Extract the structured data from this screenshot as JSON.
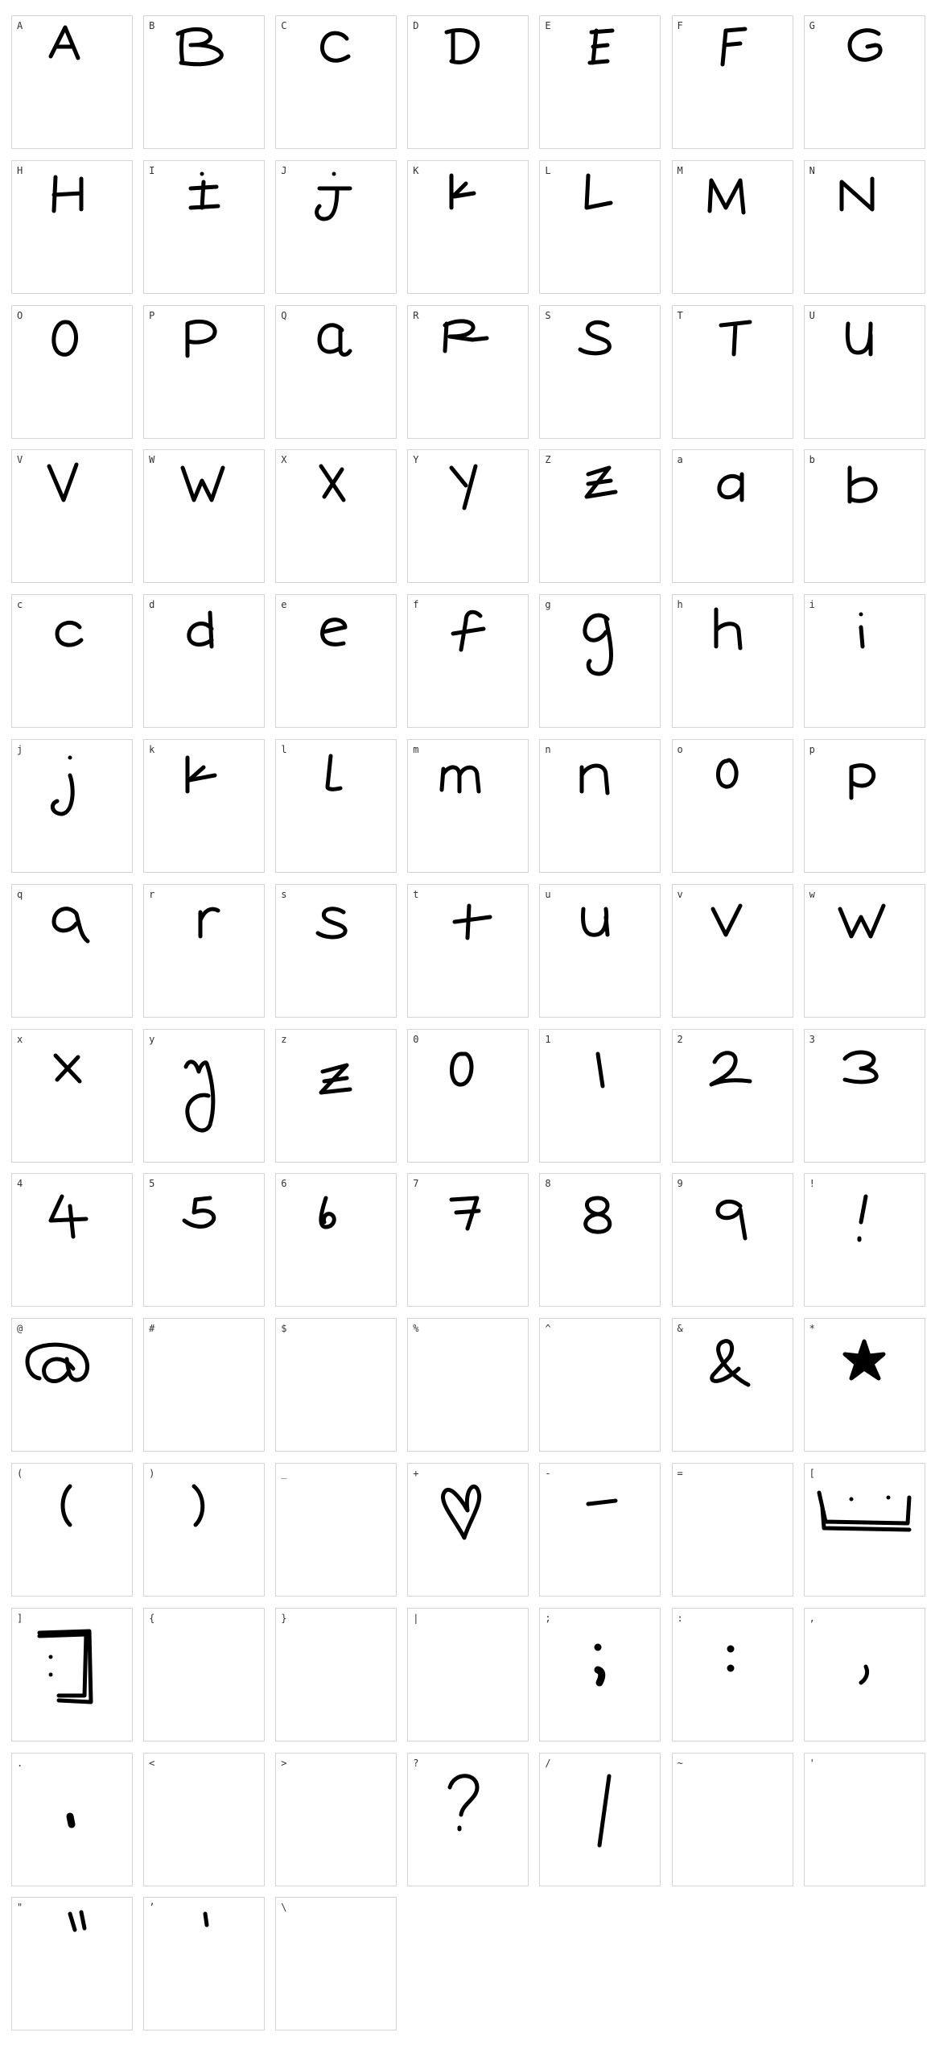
{
  "glyph_color": "#000000",
  "cell_border_color": "#d4d4d4",
  "cells": [
    {
      "label": "A",
      "drawn": true
    },
    {
      "label": "B",
      "drawn": true
    },
    {
      "label": "C",
      "drawn": true
    },
    {
      "label": "D",
      "drawn": true
    },
    {
      "label": "E",
      "drawn": true
    },
    {
      "label": "F",
      "drawn": true
    },
    {
      "label": "G",
      "drawn": true
    },
    {
      "label": "H",
      "drawn": true
    },
    {
      "label": "I",
      "drawn": true
    },
    {
      "label": "J",
      "drawn": true
    },
    {
      "label": "K",
      "drawn": true
    },
    {
      "label": "L",
      "drawn": true
    },
    {
      "label": "M",
      "drawn": true
    },
    {
      "label": "N",
      "drawn": true
    },
    {
      "label": "O",
      "drawn": true
    },
    {
      "label": "P",
      "drawn": true
    },
    {
      "label": "Q",
      "drawn": true
    },
    {
      "label": "R",
      "drawn": true
    },
    {
      "label": "S",
      "drawn": true
    },
    {
      "label": "T",
      "drawn": true
    },
    {
      "label": "U",
      "drawn": true
    },
    {
      "label": "V",
      "drawn": true
    },
    {
      "label": "W",
      "drawn": true
    },
    {
      "label": "X",
      "drawn": true
    },
    {
      "label": "Y",
      "drawn": true
    },
    {
      "label": "Z",
      "drawn": true
    },
    {
      "label": "a",
      "drawn": true
    },
    {
      "label": "b",
      "drawn": true
    },
    {
      "label": "c",
      "drawn": true
    },
    {
      "label": "d",
      "drawn": true
    },
    {
      "label": "e",
      "drawn": true
    },
    {
      "label": "f",
      "drawn": true
    },
    {
      "label": "g",
      "drawn": true
    },
    {
      "label": "h",
      "drawn": true
    },
    {
      "label": "i",
      "drawn": true
    },
    {
      "label": "j",
      "drawn": true
    },
    {
      "label": "k",
      "drawn": true
    },
    {
      "label": "l",
      "drawn": true
    },
    {
      "label": "m",
      "drawn": true
    },
    {
      "label": "n",
      "drawn": true
    },
    {
      "label": "o",
      "drawn": true
    },
    {
      "label": "p",
      "drawn": true
    },
    {
      "label": "q",
      "drawn": true
    },
    {
      "label": "r",
      "drawn": true
    },
    {
      "label": "s",
      "drawn": true
    },
    {
      "label": "t",
      "drawn": true
    },
    {
      "label": "u",
      "drawn": true
    },
    {
      "label": "v",
      "drawn": true
    },
    {
      "label": "w",
      "drawn": true
    },
    {
      "label": "x",
      "drawn": true
    },
    {
      "label": "y",
      "drawn": true
    },
    {
      "label": "z",
      "drawn": true
    },
    {
      "label": "0",
      "drawn": true
    },
    {
      "label": "1",
      "drawn": true
    },
    {
      "label": "2",
      "drawn": true
    },
    {
      "label": "3",
      "drawn": true
    },
    {
      "label": "4",
      "drawn": true
    },
    {
      "label": "5",
      "drawn": true
    },
    {
      "label": "6",
      "drawn": true
    },
    {
      "label": "7",
      "drawn": true
    },
    {
      "label": "8",
      "drawn": true
    },
    {
      "label": "9",
      "drawn": true
    },
    {
      "label": "!",
      "drawn": true
    },
    {
      "label": "@",
      "drawn": true
    },
    {
      "label": "#",
      "drawn": false
    },
    {
      "label": "$",
      "drawn": false
    },
    {
      "label": "%",
      "drawn": false
    },
    {
      "label": "^",
      "drawn": false
    },
    {
      "label": "&",
      "drawn": true
    },
    {
      "label": "*",
      "drawn": true
    },
    {
      "label": "(",
      "drawn": true
    },
    {
      "label": ")",
      "drawn": true
    },
    {
      "label": "_",
      "drawn": false
    },
    {
      "label": "+",
      "drawn": true
    },
    {
      "label": "-",
      "drawn": true
    },
    {
      "label": "=",
      "drawn": false
    },
    {
      "label": "[",
      "drawn": true
    },
    {
      "label": "]",
      "drawn": true
    },
    {
      "label": "{",
      "drawn": false
    },
    {
      "label": "}",
      "drawn": false
    },
    {
      "label": "|",
      "drawn": false
    },
    {
      "label": ";",
      "drawn": true
    },
    {
      "label": ":",
      "drawn": true
    },
    {
      "label": ",",
      "drawn": true
    },
    {
      "label": ".",
      "drawn": true
    },
    {
      "label": "<",
      "drawn": false
    },
    {
      "label": ">",
      "drawn": false
    },
    {
      "label": "?",
      "drawn": true
    },
    {
      "label": "/",
      "drawn": true
    },
    {
      "label": "~",
      "drawn": false
    },
    {
      "label": "'",
      "drawn": false
    },
    {
      "label": "\"",
      "drawn": true
    },
    {
      "label": "’",
      "drawn": true
    },
    {
      "label": "\\",
      "drawn": false
    }
  ]
}
